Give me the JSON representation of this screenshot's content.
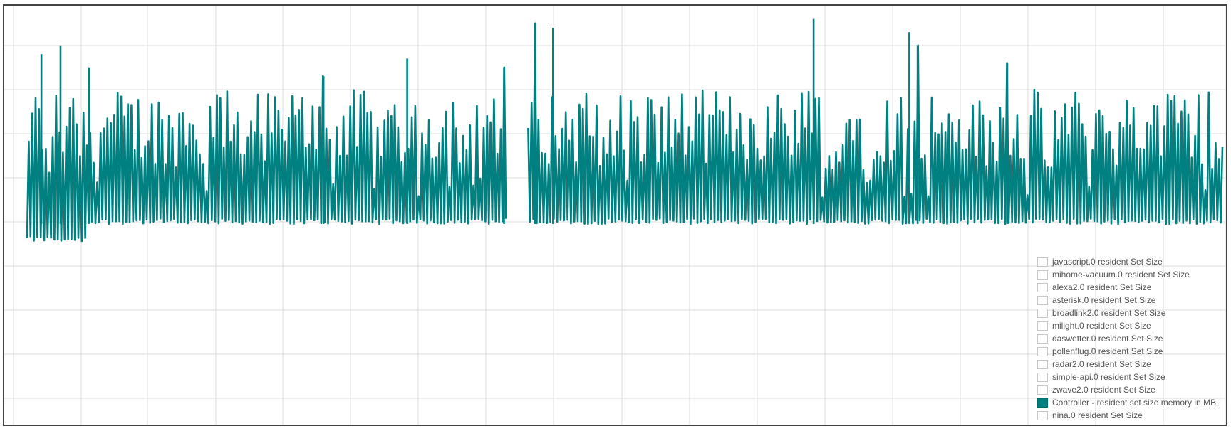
{
  "chart_data": {
    "type": "line",
    "title": "",
    "xlabel": "",
    "ylabel": "",
    "x_range": [
      0,
      1000
    ],
    "ylim": [
      0,
      9.5
    ],
    "grid": true,
    "legend_position": "bottom-right",
    "active_color": "#008080",
    "series": [
      {
        "name": "javascript.0 resident Set Size",
        "active": false
      },
      {
        "name": "mihome-vacuum.0 resident Set Size",
        "active": false
      },
      {
        "name": "alexa2.0 resident Set Size",
        "active": false
      },
      {
        "name": "asterisk.0 resident Set Size",
        "active": false
      },
      {
        "name": "broadlink2.0 resident Set Size",
        "active": false
      },
      {
        "name": "milight.0 resident Set Size",
        "active": false
      },
      {
        "name": "daswetter.0 resident Set Size",
        "active": false
      },
      {
        "name": "pollenflug.0 resident Set Size",
        "active": false
      },
      {
        "name": "radar2.0 resident Set Size",
        "active": false
      },
      {
        "name": "simple-api.0 resident Set Size",
        "active": false
      },
      {
        "name": "zwave2.0 resident Set Size",
        "active": false
      },
      {
        "name": "Controller - resident set size memory in MB",
        "active": true,
        "data": {
          "x_start": 0,
          "x_end": 1000,
          "count": 700,
          "base_low": 4.55,
          "early_low": 4.15,
          "high_min": 5.9,
          "high_max": 7.6,
          "spikes": [
            {
              "x": 12,
              "y": 8.4
            },
            {
              "x": 28,
              "y": 8.6
            },
            {
              "x": 52,
              "y": 8.1
            },
            {
              "x": 248,
              "y": 7.9
            },
            {
              "x": 318,
              "y": 8.3
            },
            {
              "x": 399,
              "y": 8.1
            },
            {
              "x": 425,
              "y": 9.1
            },
            {
              "x": 440,
              "y": 9.0
            },
            {
              "x": 658,
              "y": 9.2
            },
            {
              "x": 738,
              "y": 8.9
            },
            {
              "x": 745,
              "y": 8.6
            },
            {
              "x": 820,
              "y": 8.2
            }
          ],
          "gap": [
            402,
            418
          ]
        }
      },
      {
        "name": "nina.0 resident Set Size",
        "active": false
      }
    ]
  }
}
